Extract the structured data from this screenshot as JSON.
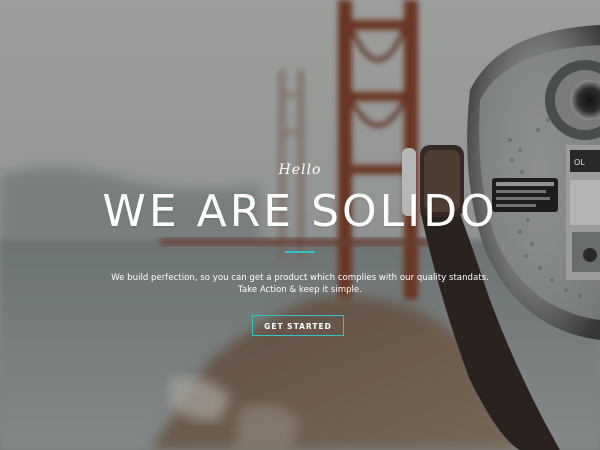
{
  "hero": {
    "greeting": "Hello",
    "headline": "WE ARE SOLIDO",
    "tagline_line1": "We build perfection, so you can get a product which complies with our quality standats.",
    "tagline_line2": "Take Action & keep it simple.",
    "cta_label": "GET STARTED",
    "plate_text": "OL"
  },
  "colors": {
    "accent": "#35c3c9",
    "text": "#ffffff"
  }
}
